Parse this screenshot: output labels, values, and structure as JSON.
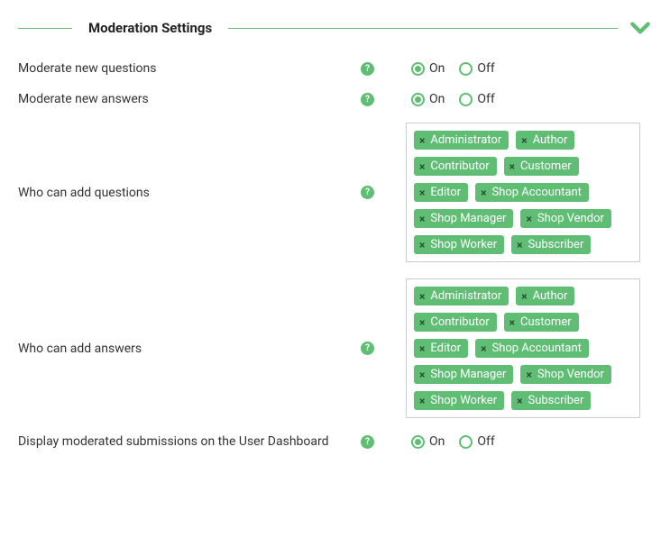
{
  "section": {
    "title": "Moderation Settings"
  },
  "radio": {
    "on": "On",
    "off": "Off"
  },
  "fields": {
    "moderate_questions": {
      "label": "Moderate new questions",
      "value": "on"
    },
    "moderate_answers": {
      "label": "Moderate new answers",
      "value": "on"
    },
    "who_add_questions": {
      "label": "Who can add questions",
      "roles": [
        "Administrator",
        "Author",
        "Contributor",
        "Customer",
        "Editor",
        "Shop Accountant",
        "Shop Manager",
        "Shop Vendor",
        "Shop Worker",
        "Subscriber"
      ]
    },
    "who_add_answers": {
      "label": "Who can add answers",
      "roles": [
        "Administrator",
        "Author",
        "Contributor",
        "Customer",
        "Editor",
        "Shop Accountant",
        "Shop Manager",
        "Shop Vendor",
        "Shop Worker",
        "Subscriber"
      ]
    },
    "display_on_dashboard": {
      "label": "Display moderated submissions on the User Dashboard",
      "value": "on"
    }
  },
  "colors": {
    "accent": "#5fbd74"
  }
}
